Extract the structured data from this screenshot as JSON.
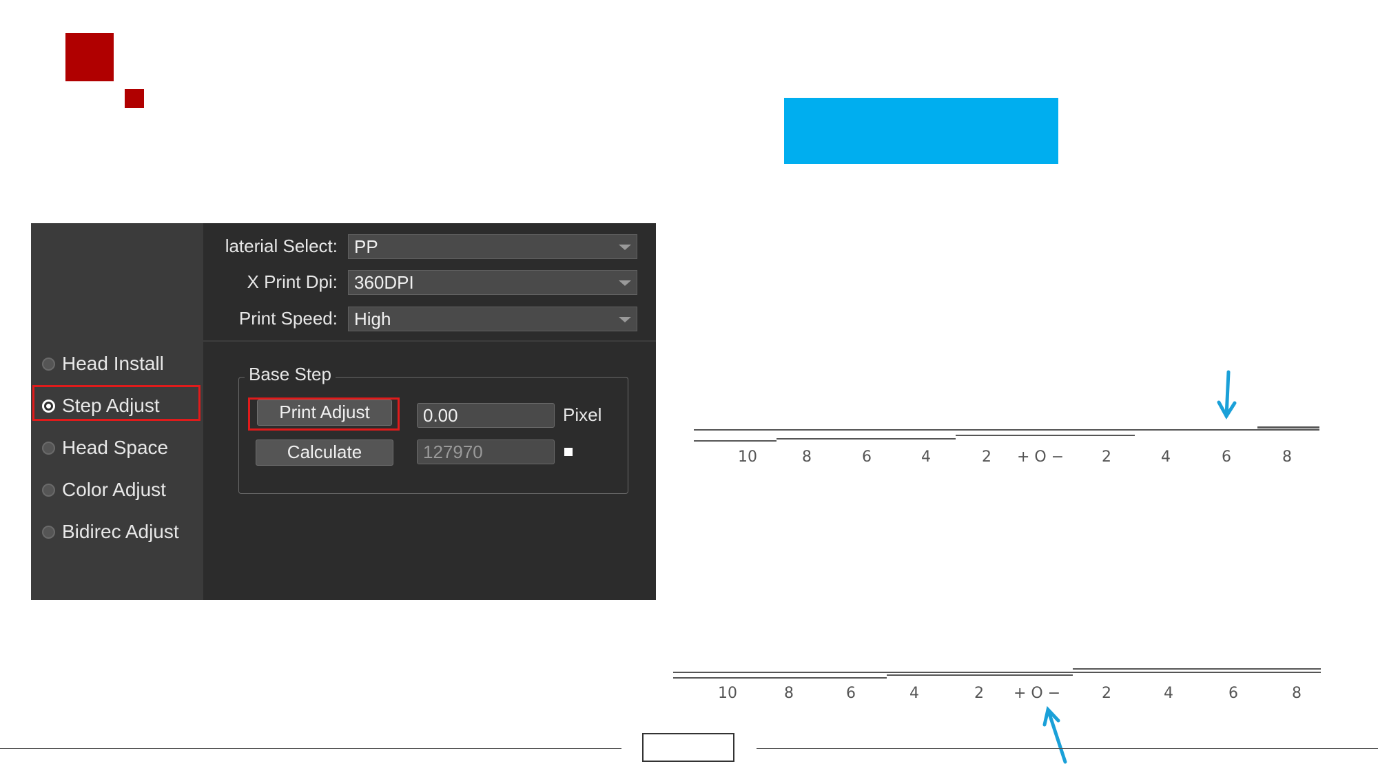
{
  "brand": {
    "accent": "#b00000",
    "title_bar_color": "#00aeef"
  },
  "dialog": {
    "sidebar": {
      "items": [
        {
          "label": "Head Install",
          "selected": false
        },
        {
          "label": "Step Adjust",
          "selected": true
        },
        {
          "label": "Head Space",
          "selected": false
        },
        {
          "label": "Color Adjust",
          "selected": false
        },
        {
          "label": "Bidirec Adjust",
          "selected": false
        }
      ]
    },
    "fields": {
      "material_label": "laterial Select:",
      "material_value": "PP",
      "dpi_label": "X Print Dpi:",
      "dpi_value": "360DPI",
      "speed_label": "Print Speed:",
      "speed_value": "High"
    },
    "base_step": {
      "title": "Base Step",
      "print_adjust_label": "Print Adjust",
      "step_value": "0.00",
      "unit": "Pixel",
      "calculate_label": "Calculate",
      "calc_value": "127970"
    }
  },
  "scales": [
    {
      "ticks": [
        "10",
        "8",
        "6",
        "4",
        "2",
        "+ O −",
        "2",
        "4",
        "6",
        "8"
      ],
      "marked": "6"
    },
    {
      "ticks": [
        "10",
        "8",
        "6",
        "4",
        "2",
        "+ O −",
        "2",
        "4",
        "6",
        "8"
      ],
      "marked": "O"
    }
  ],
  "icons": {
    "arrow_color": "#1aa0d8"
  }
}
